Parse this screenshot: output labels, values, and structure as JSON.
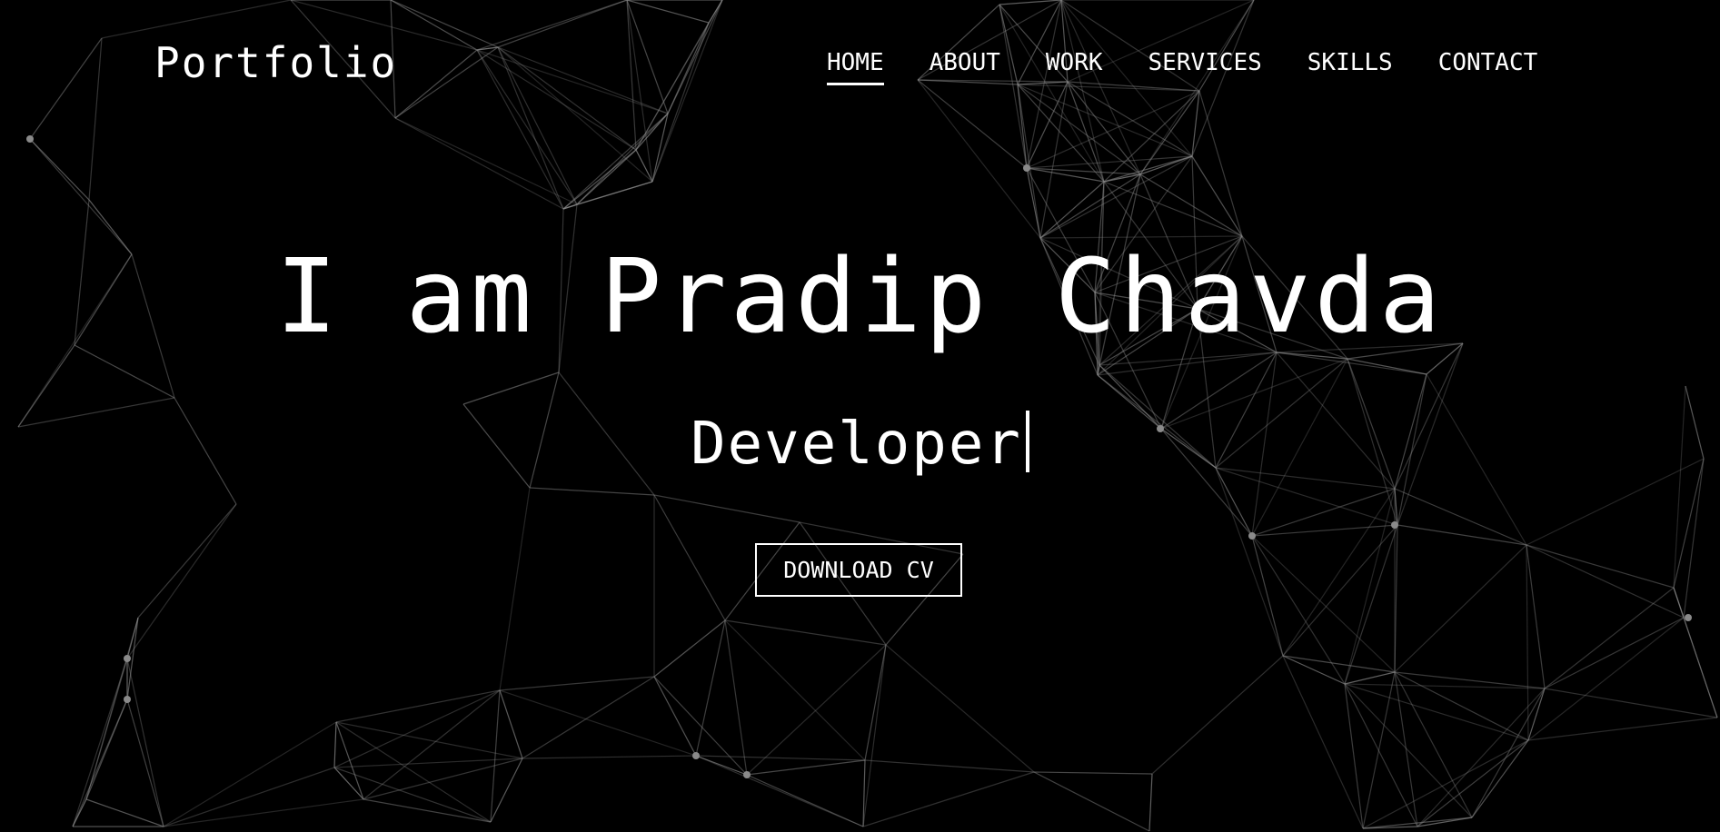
{
  "header": {
    "brand": "Portfolio",
    "nav": [
      {
        "label": "HOME",
        "active": true
      },
      {
        "label": "ABOUT",
        "active": false
      },
      {
        "label": "WORK",
        "active": false
      },
      {
        "label": "SERVICES",
        "active": false
      },
      {
        "label": "SKILLS",
        "active": false
      },
      {
        "label": "CONTACT",
        "active": false
      }
    ]
  },
  "hero": {
    "title": "I am Pradip Chavda",
    "role": "Developer",
    "cta_label": "DOWNLOAD CV"
  },
  "colors": {
    "background": "#000000",
    "text": "#ffffff",
    "network_lines": "#8a8a8a"
  }
}
